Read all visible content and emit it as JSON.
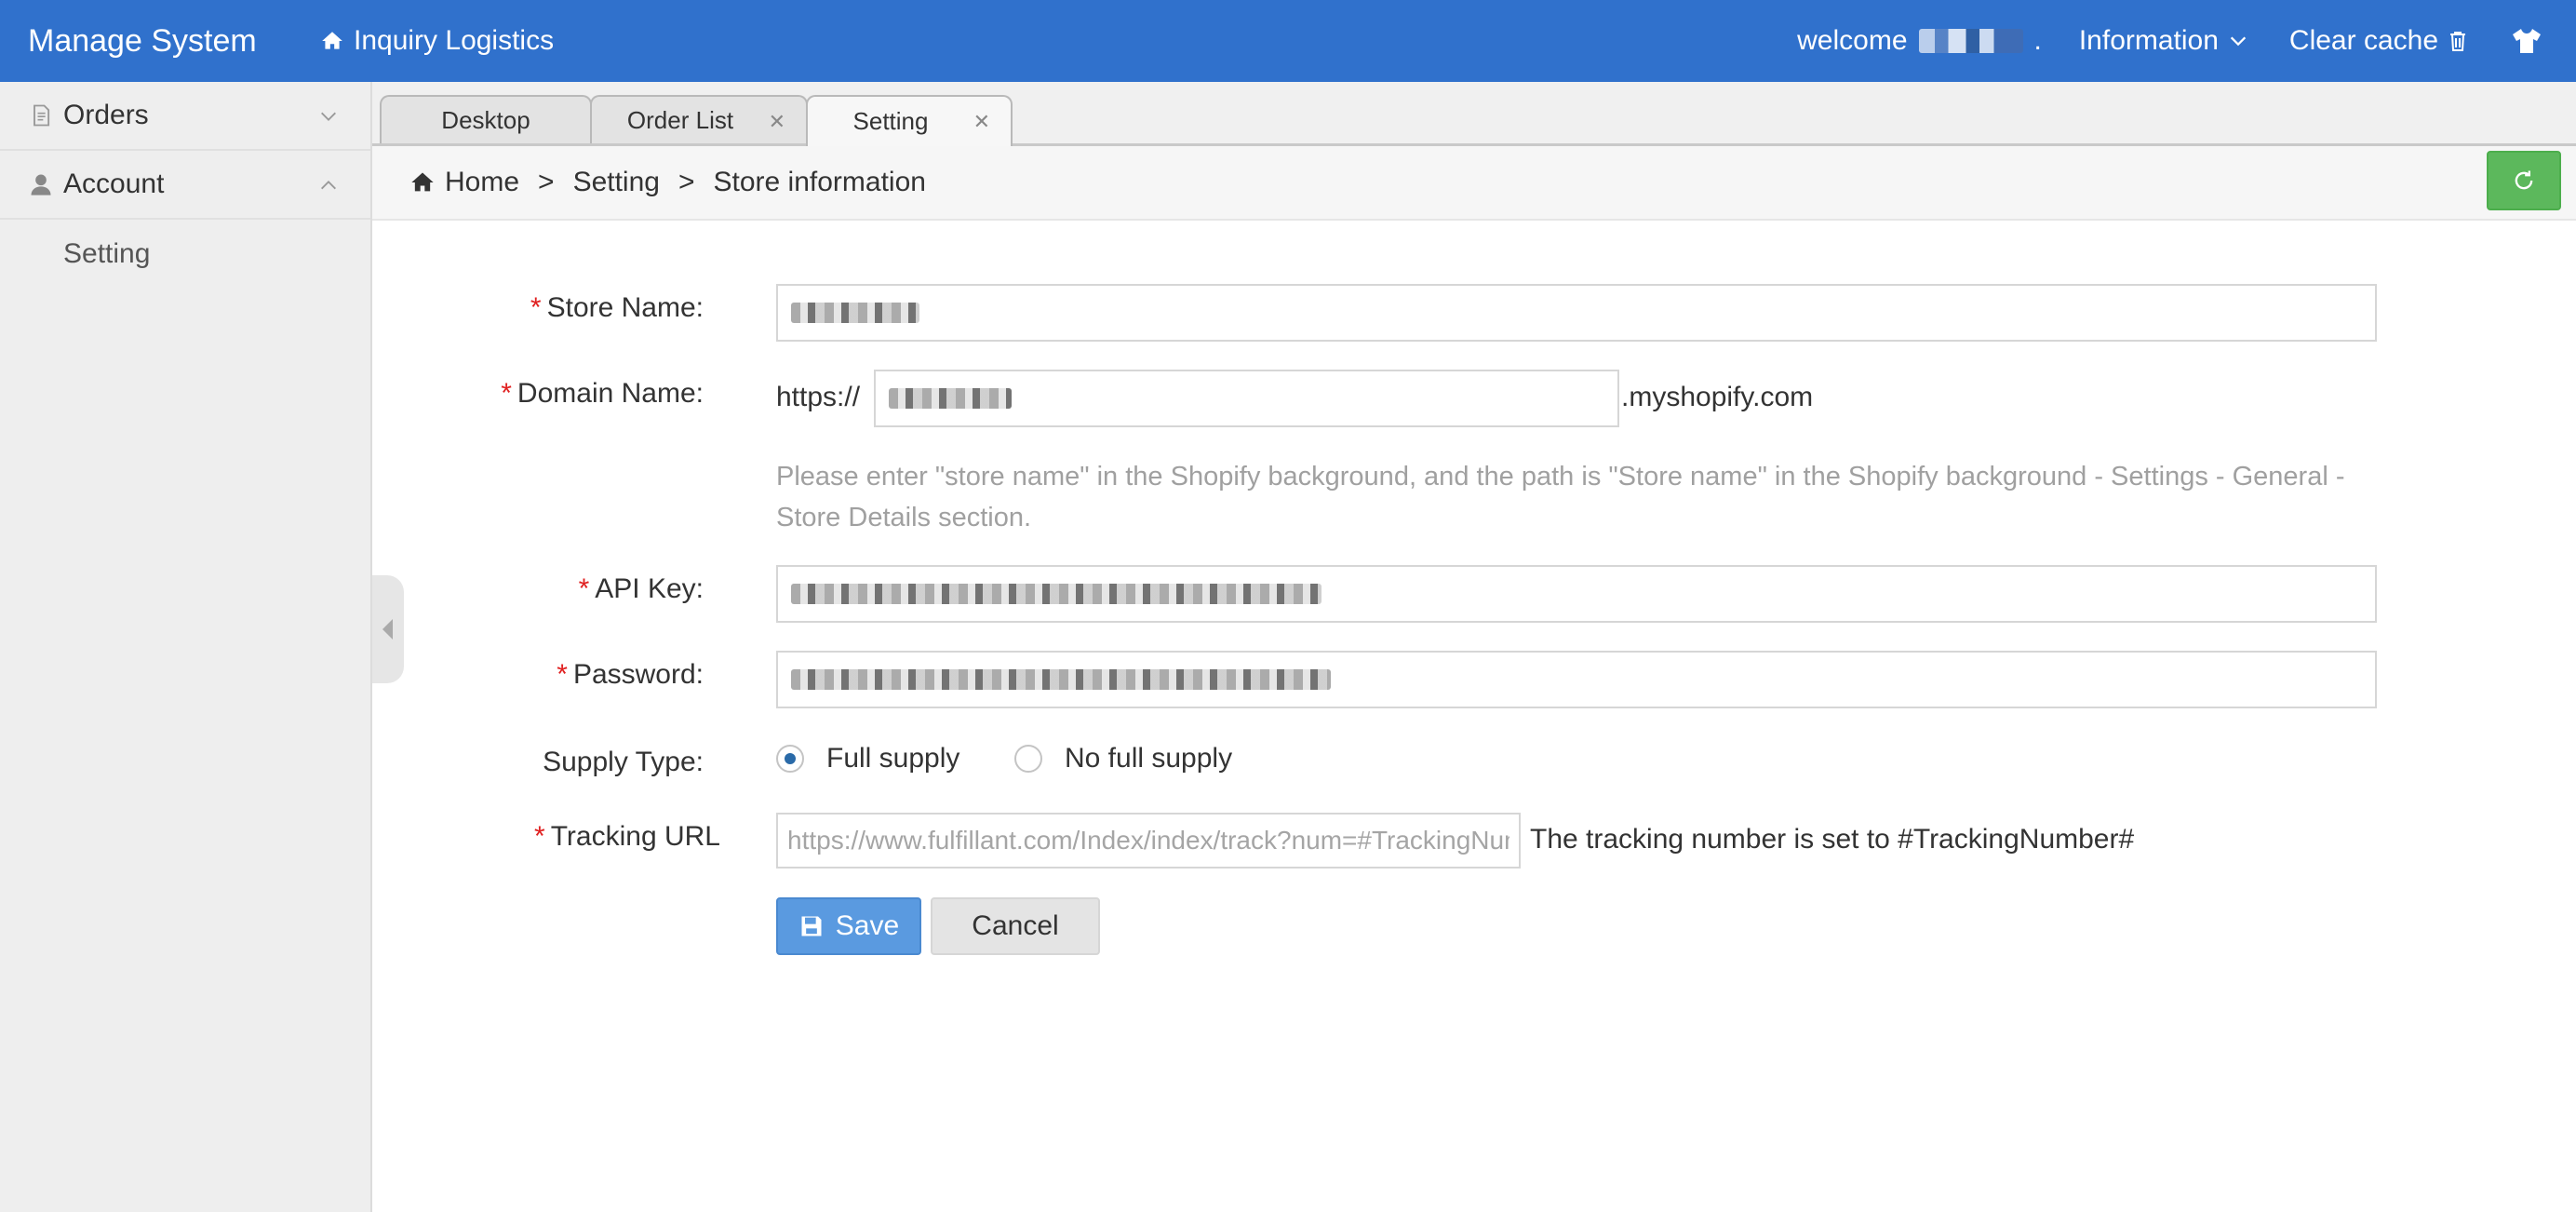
{
  "header": {
    "brand": "Manage System",
    "inquiry_label": "Inquiry Logistics",
    "welcome_label": "welcome",
    "welcome_suffix": ".",
    "information_label": "Information",
    "clear_cache_label": "Clear cache"
  },
  "sidebar": {
    "menus": [
      {
        "label": "Orders",
        "expanded": false
      },
      {
        "label": "Account",
        "expanded": true,
        "items": [
          {
            "label": "Setting"
          }
        ]
      }
    ]
  },
  "tabs": [
    {
      "label": "Desktop",
      "active": false,
      "closable": false
    },
    {
      "label": "Order List",
      "active": false,
      "closable": true
    },
    {
      "label": "Setting",
      "active": true,
      "closable": true
    }
  ],
  "breadcrumb": {
    "home": "Home",
    "separator": ">",
    "level2": "Setting",
    "level3": "Store information"
  },
  "form": {
    "store_name_label": "Store Name:",
    "domain_name_label": "Domain Name:",
    "domain_prefix": "https://",
    "domain_suffix": ".myshopify.com",
    "hint": "Please enter \"store name\" in the Shopify background, and the path is \"Store name\" in the Shopify background - Settings - General - Store Details section.",
    "api_key_label": "API Key:",
    "password_label": "Password:",
    "supply_type_label": "Supply Type:",
    "supply_options": [
      {
        "label": "Full supply",
        "selected": true
      },
      {
        "label": "No full supply",
        "selected": false
      }
    ],
    "tracking_url_label": "Tracking URL",
    "tracking_url_placeholder": "https://www.fulfillant.com/Index/index/track?num=#TrackingNumber#",
    "tracking_note": "The tracking number is set to #TrackingNumber#",
    "required_mark": "*",
    "save_label": "Save",
    "cancel_label": "Cancel"
  },
  "colors": {
    "header_bg": "#3071cc",
    "save_button": "#5a9ae0",
    "refresh_button": "#5cb85c",
    "required": "#e02020"
  }
}
